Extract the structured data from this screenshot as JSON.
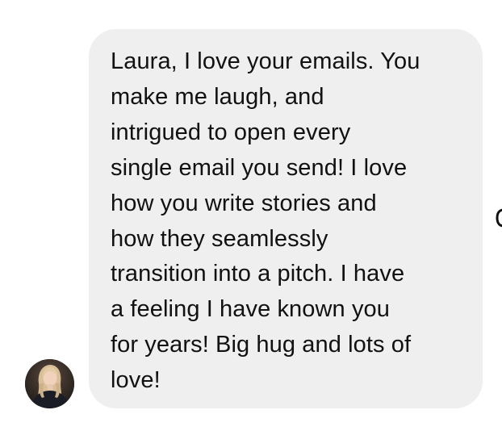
{
  "message": {
    "lines": [
      "Laura, I love your emails. You",
      "make me laugh, and",
      "intrigued to open every",
      "single email you send! I love",
      "how you write stories and",
      "how they seamlessly",
      "transition into a pitch. I have",
      "a feeling I have known you",
      "for years! Big hug and lots of",
      "love!"
    ]
  },
  "sender": {
    "avatar_icon": "profile-photo-avatar"
  },
  "colors": {
    "bubble_bg": "#efefef",
    "text": "#111111",
    "page_bg": "#ffffff"
  }
}
